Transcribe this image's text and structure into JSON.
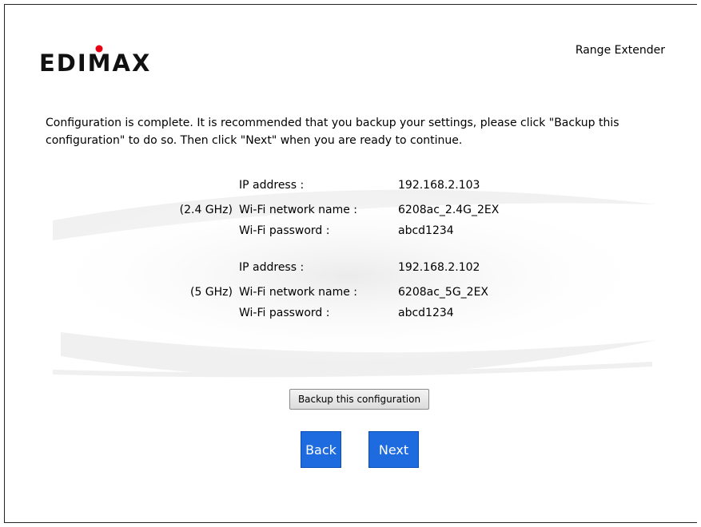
{
  "brand": {
    "logo_text": "EDIMAX",
    "logo_dot_color": "#e60012",
    "logo_color": "#111111"
  },
  "header": {
    "product": "Range Extender"
  },
  "intro": "Configuration is complete. It is recommended that you backup your settings, please click \"Backup this configuration\" to do so. Then click \"Next\" when you are ready to continue.",
  "networks": [
    {
      "band": "(2.4 GHz)",
      "ip_label": "IP address :",
      "ip": "192.168.2.103",
      "ssid_label": "Wi-Fi network name :",
      "ssid": "6208ac_2.4G_2EX",
      "pw_label": "Wi-Fi password :",
      "pw": "abcd1234"
    },
    {
      "band": "(5 GHz)",
      "ip_label": "IP address :",
      "ip": "192.168.2.102",
      "ssid_label": "Wi-Fi network name :",
      "ssid": "6208ac_5G_2EX",
      "pw_label": "Wi-Fi password :",
      "pw": "abcd1234"
    }
  ],
  "buttons": {
    "backup": "Backup this configuration",
    "back": "Back",
    "next": "Next"
  },
  "colors": {
    "primary_button": "#1e6be0",
    "secondary_button": "#e6e6e6"
  }
}
